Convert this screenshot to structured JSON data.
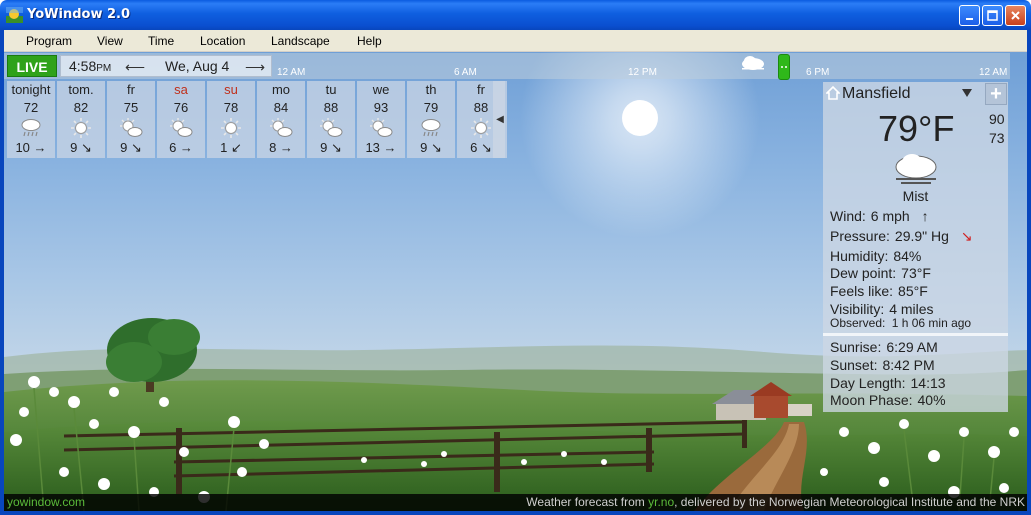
{
  "window": {
    "title": "YoWindow 2.0"
  },
  "menu": [
    "Program",
    "View",
    "Time",
    "Location",
    "Landscape",
    "Help"
  ],
  "timebar": {
    "live_label": "LIVE",
    "time": "4:58",
    "ampm": "PM",
    "date": "We, Aug 4",
    "timeline_labels": [
      "12 AM",
      "6 AM",
      "12 PM",
      "6 PM",
      "12 AM"
    ]
  },
  "forecast": [
    {
      "name": "tonight",
      "temp": "72",
      "icon": "rain-shower-icon",
      "wind": "10",
      "dir": "→",
      "weekend": false
    },
    {
      "name": "tom.",
      "temp": "82",
      "icon": "sun-icon",
      "wind": "9",
      "dir": "↘",
      "weekend": false
    },
    {
      "name": "fr",
      "temp": "75",
      "icon": "partly-cloudy-icon",
      "wind": "9",
      "dir": "↘",
      "weekend": false
    },
    {
      "name": "sa",
      "temp": "76",
      "icon": "partly-cloudy-icon",
      "wind": "6",
      "dir": "→",
      "weekend": true
    },
    {
      "name": "su",
      "temp": "78",
      "icon": "sun-icon",
      "wind": "1",
      "dir": "↙",
      "weekend": true
    },
    {
      "name": "mo",
      "temp": "84",
      "icon": "partly-cloudy-icon",
      "wind": "8",
      "dir": "→",
      "weekend": false
    },
    {
      "name": "tu",
      "temp": "88",
      "icon": "partly-cloudy-icon",
      "wind": "9",
      "dir": "↘",
      "weekend": false
    },
    {
      "name": "we",
      "temp": "93",
      "icon": "partly-cloudy-icon",
      "wind": "13",
      "dir": "→",
      "weekend": false
    },
    {
      "name": "th",
      "temp": "79",
      "icon": "rain-shower-icon",
      "wind": "9",
      "dir": "↘",
      "weekend": false
    },
    {
      "name": "fr",
      "temp": "88",
      "icon": "sun-icon",
      "wind": "6",
      "dir": "↘",
      "weekend": false
    }
  ],
  "current": {
    "location": "Mansfield",
    "plus": "+",
    "temperature": "79°F",
    "high": "90",
    "low": "73",
    "condition": "Mist",
    "wind_label": "Wind:",
    "wind_value": "6 mph",
    "wind_arrow": "↑",
    "pressure_label": "Pressure:",
    "pressure_value": "29.9\" Hg",
    "pressure_arrow": "↘",
    "humidity_label": "Humidity:",
    "humidity_value": "84%",
    "dew_label": "Dew point:",
    "dew_value": "73°F",
    "feels_label": "Feels like:",
    "feels_value": "85°F",
    "visibility_label": "Visibility:",
    "visibility_value": "4 miles",
    "observed_label": "Observed:",
    "observed_value": "1 h 06 min ago",
    "sunrise_label": "Sunrise:",
    "sunrise_value": "6:29 AM",
    "sunset_label": "Sunset:",
    "sunset_value": "8:42 PM",
    "daylength_label": "Day Length:",
    "daylength_value": "14:13",
    "moon_label": "Moon Phase:",
    "moon_value": "40%"
  },
  "footer": {
    "site": "yowindow.com",
    "credit_prefix": "Weather forecast from ",
    "credit_source": "yr.no",
    "credit_suffix": ", delivered by the Norwegian Meteorological Institute and the NRK"
  },
  "colors": {
    "live": "#2fa21a",
    "weekend": "#c0301c",
    "titlebar": "#0a4fd0"
  }
}
